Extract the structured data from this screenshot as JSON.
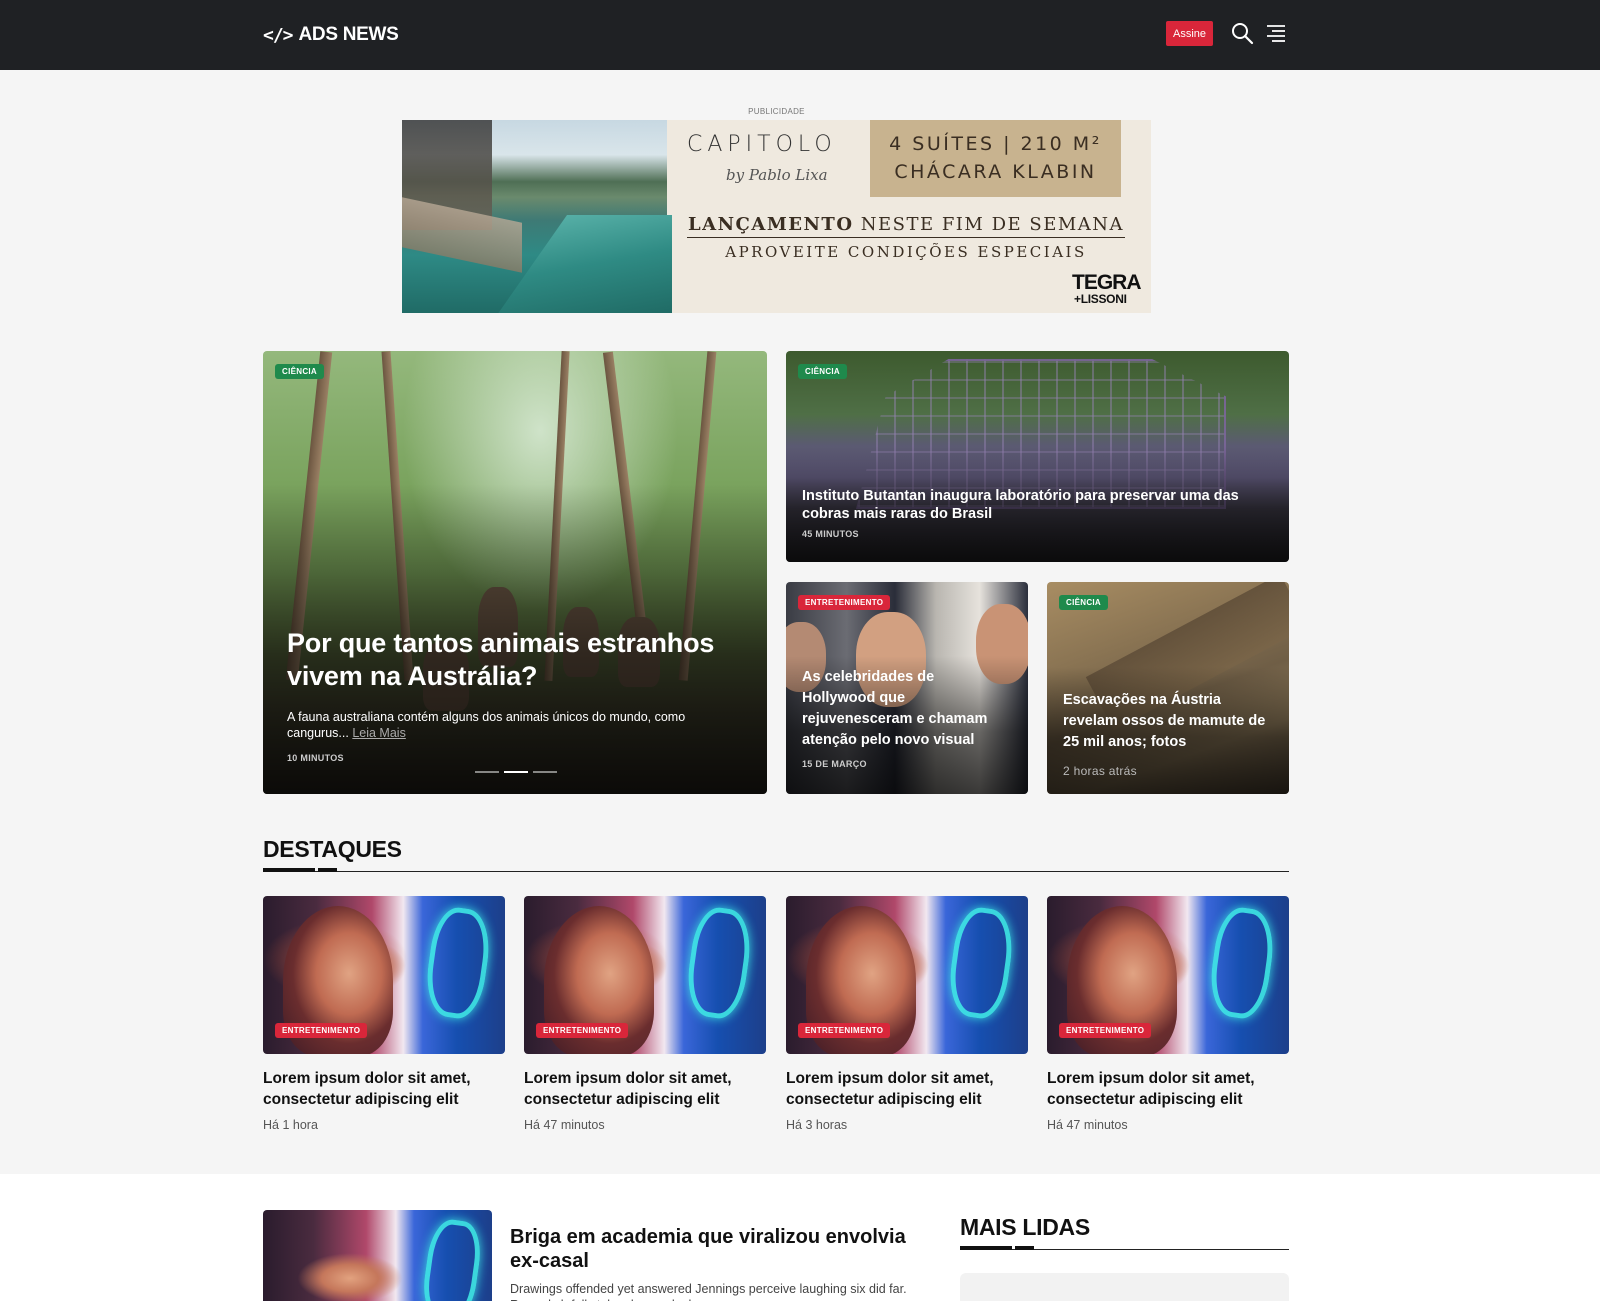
{
  "header": {
    "logo_mark": "</>",
    "logo_text": "ADS NEWS",
    "subscribe_label": "Assine",
    "search_icon": "search-icon",
    "menu_icon": "menu-icon"
  },
  "ad": {
    "label": "PUBLICIDADE",
    "brand": "CAPITOLO",
    "by": "by Pablo Lixa",
    "box_line1": "4 SUÍTES | 210 M²",
    "box_line2": "CHÁCARA KLABIN",
    "headline_bold": "LANÇAMENTO",
    "headline_rest": "NESTE FIM DE SEMANA",
    "subline": "APROVEITE CONDIÇÕES ESPECIAIS",
    "logo_line1": "TEGRA",
    "logo_line2": "+LISSONI"
  },
  "hero": {
    "main": {
      "tag": "CIÊNCIA",
      "title": "Por que tantos animais estranhos vivem na Austrália?",
      "summary": "A fauna australiana contém alguns dos animais únicos do mundo, como cangurus...",
      "read_more": "Leia Mais",
      "meta": "10 MINUTOS"
    },
    "top_right": {
      "tag": "CIÊNCIA",
      "title": "Instituto Butantan inaugura laboratório para preservar uma das cobras mais raras do Brasil",
      "meta": "45 MINUTOS"
    },
    "bottom_left": {
      "tag": "ENTRETENIMENTO",
      "title": "As celebridades de Hollywood que rejuvenesceram e chamam atenção pelo novo visual",
      "meta": "15 DE MARÇO"
    },
    "bottom_right": {
      "tag": "CIÊNCIA",
      "title": "Escavações na Áustria revelam ossos de mamute de 25 mil anos; fotos",
      "meta": "2 horas atrás"
    }
  },
  "destaques": {
    "title": "DESTAQUES",
    "items": [
      {
        "tag": "ENTRETENIMENTO",
        "title": "Lorem ipsum dolor sit amet, consectetur adipiscing elit",
        "time": "Há 1 hora"
      },
      {
        "tag": "ENTRETENIMENTO",
        "title": "Lorem ipsum dolor sit amet, consectetur adipiscing elit",
        "time": "Há 47 minutos"
      },
      {
        "tag": "ENTRETENIMENTO",
        "title": "Lorem ipsum dolor sit amet, consectetur adipiscing elit",
        "time": "Há 3 horas"
      },
      {
        "tag": "ENTRETENIMENTO",
        "title": "Lorem ipsum dolor sit amet, consectetur adipiscing elit",
        "time": "Há 47 minutos"
      }
    ]
  },
  "bottom": {
    "article_title": "Briga em academia que viralizou envolvia ex-casal",
    "article_text": "Drawings offended yet answered Jennings perceive laughing six did far. Regard ch fully taken by wards do",
    "mais_lidas_title": "MAIS LIDAS"
  },
  "colors": {
    "header_bg": "#1f2124",
    "accent_red": "#d9263a",
    "tag_green": "#1f8a4c"
  }
}
